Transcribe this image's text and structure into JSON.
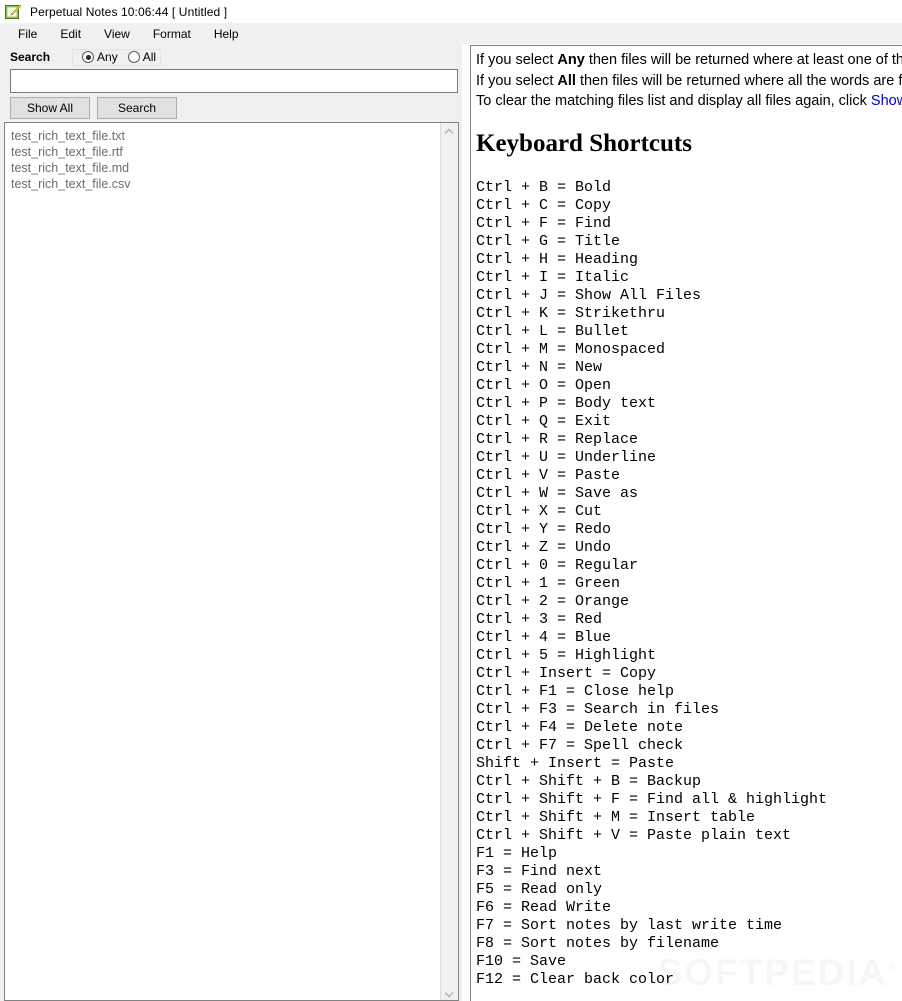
{
  "window": {
    "title": "Perpetual Notes 10:06:44 [ Untitled ]",
    "icon": "notepad-pencil-icon"
  },
  "menubar": {
    "items": [
      {
        "label": "File"
      },
      {
        "label": "Edit"
      },
      {
        "label": "View"
      },
      {
        "label": "Format"
      },
      {
        "label": "Help"
      }
    ]
  },
  "search_panel": {
    "label": "Search",
    "mode_options": [
      {
        "label": "Any",
        "selected": true
      },
      {
        "label": "All",
        "selected": false
      }
    ],
    "input_value": "",
    "input_placeholder": "",
    "buttons": [
      {
        "label": "Show All"
      },
      {
        "label": "Search"
      }
    ]
  },
  "file_list": {
    "items": [
      "test_rich_text_file.txt",
      "test_rich_text_file.rtf",
      "test_rich_text_file.md",
      "test_rich_text_file.csv"
    ],
    "scroll_up_icon": "chevron-up-icon",
    "scroll_down_icon": "chevron-down-icon"
  },
  "document": {
    "intro": [
      {
        "pre": "If you select ",
        "bold": "Any",
        "post": " then files will be returned where at least one of the words is found."
      },
      {
        "pre": "If you select ",
        "bold": "All",
        "post": "  then files will be returned where all the words are found."
      },
      {
        "pre": "To clear the matching files list and display all files again, click ",
        "bold": "",
        "post": "Show All."
      }
    ],
    "heading": "Keyboard Shortcuts",
    "shortcuts": [
      "Ctrl + B = Bold",
      "Ctrl + C = Copy",
      "Ctrl + F = Find",
      "Ctrl + G = Title",
      "Ctrl + H = Heading",
      "Ctrl + I = Italic",
      "Ctrl + J = Show All Files",
      "Ctrl + K = Strikethru",
      "Ctrl + L = Bullet",
      "Ctrl + M = Monospaced",
      "Ctrl + N = New",
      "Ctrl + O = Open",
      "Ctrl + P = Body text",
      "Ctrl + Q = Exit",
      "Ctrl + R = Replace",
      "Ctrl + U = Underline",
      "Ctrl + V = Paste",
      "Ctrl + W = Save as",
      "Ctrl + X = Cut",
      "Ctrl + Y = Redo",
      "Ctrl + Z = Undo",
      "Ctrl + 0 = Regular",
      "Ctrl + 1 = Green",
      "Ctrl + 2 = Orange",
      "Ctrl + 3 = Red",
      "Ctrl + 4 = Blue",
      "Ctrl + 5 = Highlight",
      "Ctrl + Insert = Copy",
      "Ctrl + F1 = Close help",
      "Ctrl + F3 = Search in files",
      "Ctrl + F4 = Delete note",
      "Ctrl + F7 = Spell check",
      "Shift + Insert = Paste",
      "Ctrl + Shift + B = Backup",
      "Ctrl + Shift + F = Find all & highlight",
      "Ctrl + Shift + M = Insert table",
      "Ctrl + Shift + V = Paste plain text",
      "F1 = Help",
      "F3 = Find next",
      "F5 = Read only",
      "F6 = Read Write",
      "F7 = Sort notes by last write time",
      "F8 = Sort notes by filename",
      "F10 = Save",
      "F12 = Clear back color"
    ]
  },
  "watermark": {
    "text": "SOFTPEDIA",
    "mark": "®"
  },
  "colors": {
    "chrome": "#f0f0f0",
    "button_face": "#e1e1e1",
    "field_border": "#7a7a7a",
    "list_text": "#6d6d6d",
    "link": "#0000cc"
  }
}
